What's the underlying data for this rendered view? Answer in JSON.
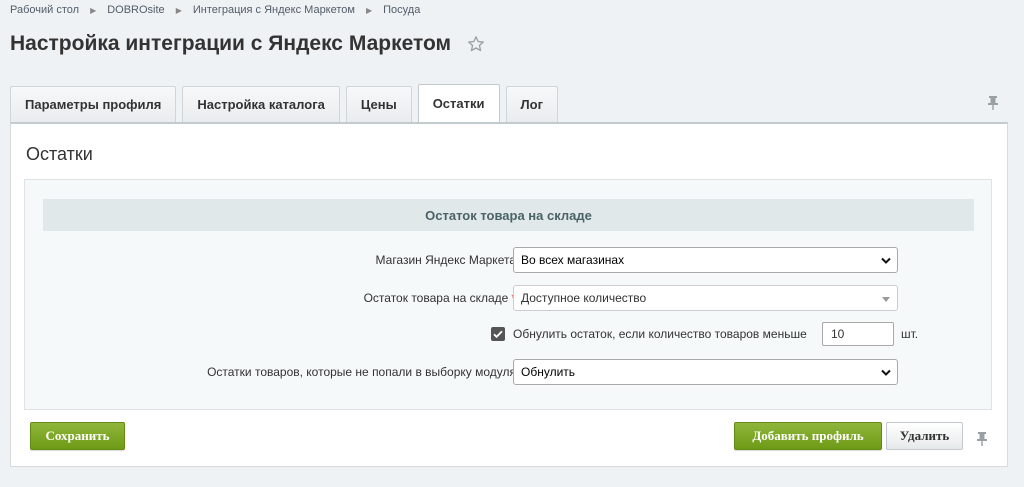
{
  "breadcrumb": [
    "Рабочий стол",
    "DOBROsite",
    "Интеграция с Яндекс Маркетом",
    "Посуда"
  ],
  "page_title": "Настройка интеграции с Яндекс Маркетом",
  "tabs": [
    {
      "label": "Параметры профиля"
    },
    {
      "label": "Настройка каталога"
    },
    {
      "label": "Цены"
    },
    {
      "label": "Остатки",
      "active": true
    },
    {
      "label": "Лог"
    }
  ],
  "panel": {
    "title": "Остатки",
    "section_title": "Остаток товара на складе",
    "store": {
      "label": "Магазин Яндекс Маркета",
      "value": "Во всех магазинах"
    },
    "stock": {
      "label": "Остаток товара на складе",
      "required_mark": "*",
      "value": "Доступное количество"
    },
    "reset": {
      "checked": true,
      "label": "Обнулить остаток, если количество товаров меньше",
      "value": "10",
      "unit": "шт."
    },
    "unselected": {
      "label": "Остатки товаров, которые не попали в выборку модуля",
      "value": "Обнулить"
    }
  },
  "buttons": {
    "save": "Сохранить",
    "add_profile": "Добавить профиль",
    "delete": "Удалить"
  },
  "colors": {
    "accent_green": "#7aa51f",
    "background": "#eef2f4"
  },
  "icons": [
    "star-icon",
    "pin-icon",
    "chevron-down-icon",
    "checkmark-icon"
  ]
}
